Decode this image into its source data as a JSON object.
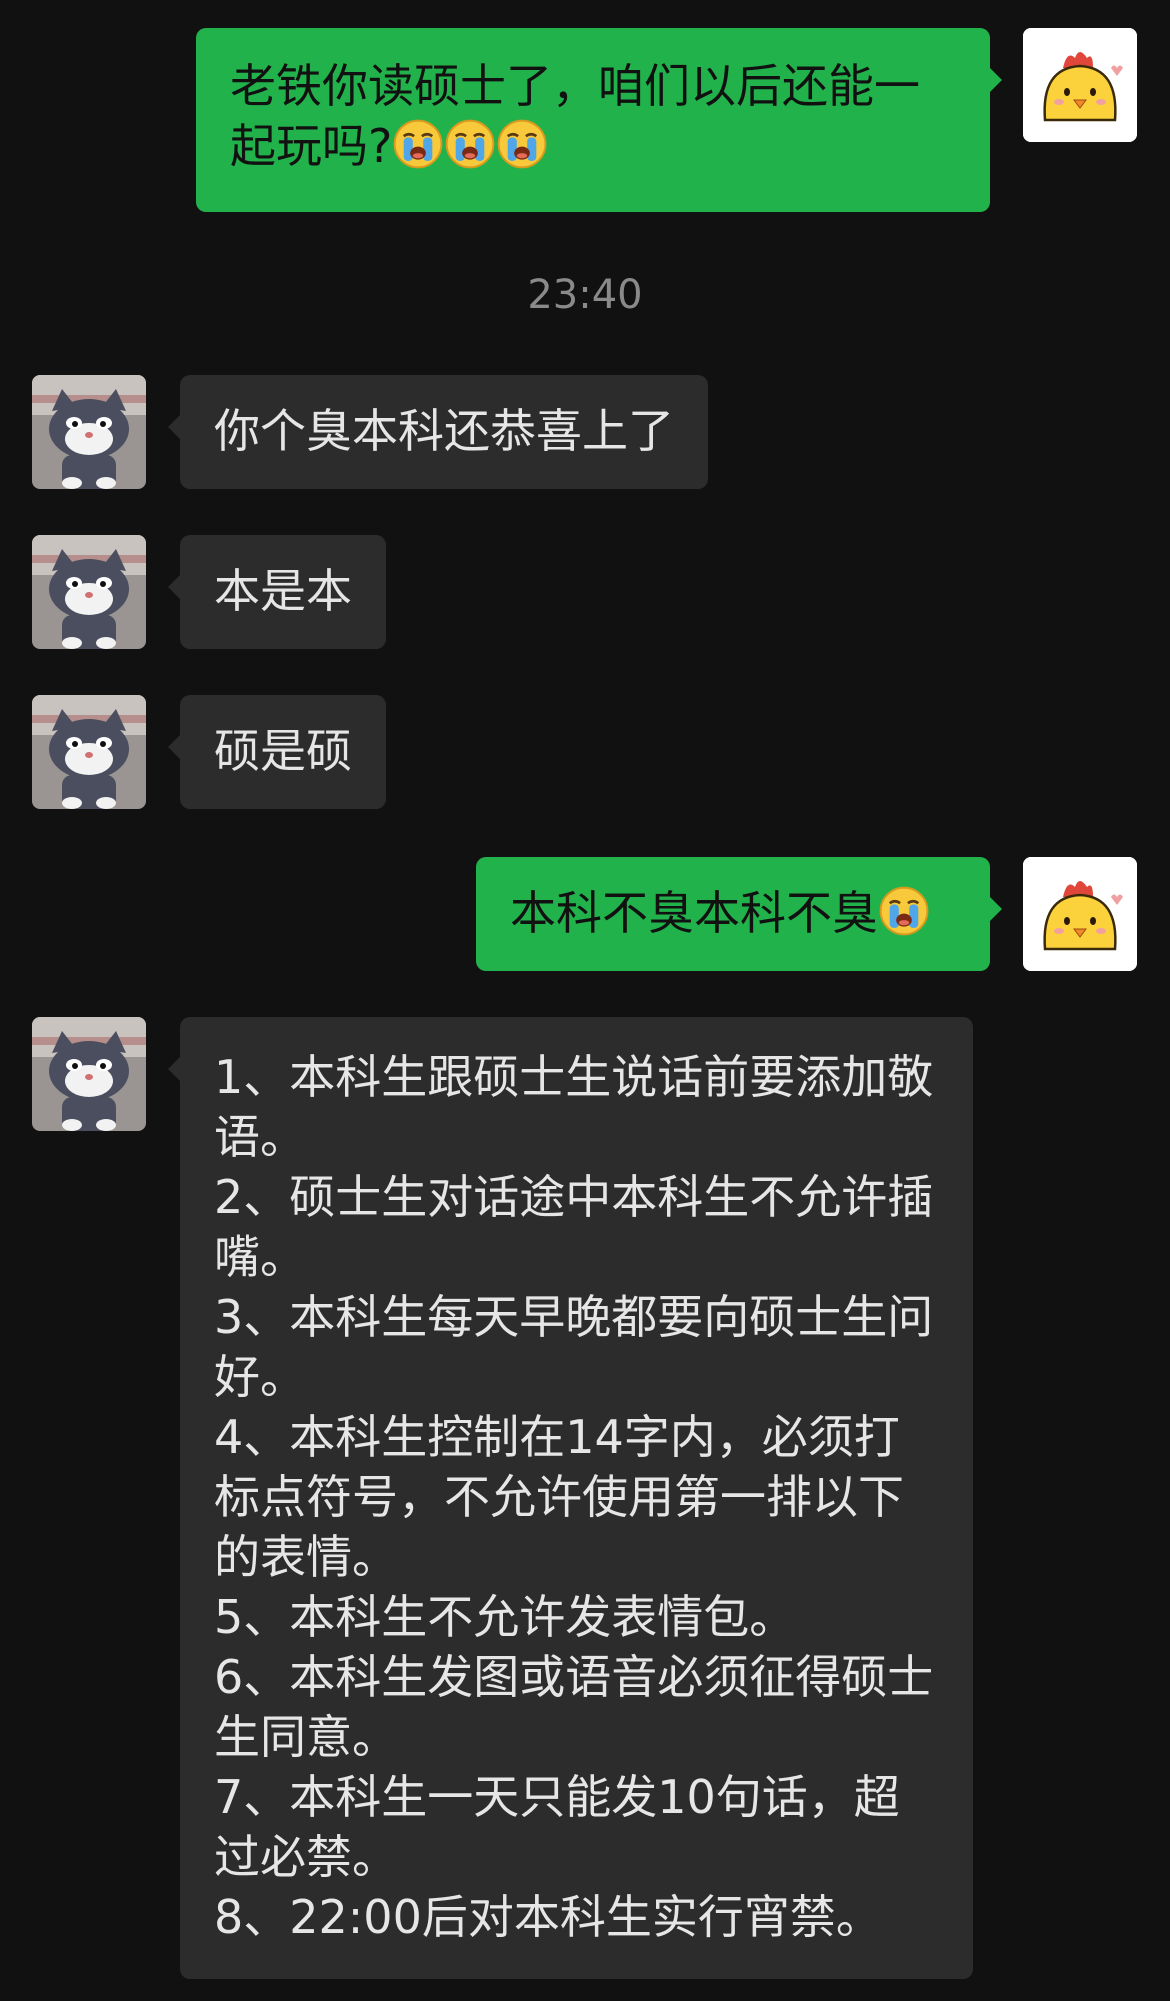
{
  "chat": {
    "timestamp": "23:40",
    "messages": [
      {
        "id": "m1",
        "side": "sent",
        "text": "老铁你读硕士了，咱们以后还能一起玩吗?",
        "emoji": "crying-face",
        "emoji_count": 3
      },
      {
        "id": "m2",
        "side": "received",
        "text": "你个臭本科还恭喜上了"
      },
      {
        "id": "m3",
        "side": "received",
        "text": "本是本"
      },
      {
        "id": "m4",
        "side": "received",
        "text": "硕是硕"
      },
      {
        "id": "m5",
        "side": "sent",
        "text": "本科不臭本科不臭",
        "emoji": "crying-face",
        "emoji_count": 1
      },
      {
        "id": "m6",
        "side": "received",
        "rules": [
          "1、本科生跟硕士生说话前要添加敬语。",
          "2、硕士生对话途中本科生不允许插嘴。",
          "3、本科生每天早晚都要向硕士生问好。",
          "4、本科生控制在14字内，必须打标点符号，不允许使用第一排以下的表情。",
          "5、本科生不允许发表情包。",
          "6、本科生发图或语音必须征得硕士生同意。",
          "7、本科生一天只能发10句话，超过必禁。",
          "8、22:00后对本科生实行宵禁。"
        ]
      }
    ]
  },
  "colors": {
    "background": "#111111",
    "sent_bubble": "#22b24c",
    "received_bubble": "#2c2c2c",
    "timestamp": "#8a8a8a"
  },
  "icons": {
    "self_avatar": "chick-avatar-icon",
    "other_avatar": "cat-avatar-icon",
    "emoji": "crying-face-emoji-icon"
  }
}
